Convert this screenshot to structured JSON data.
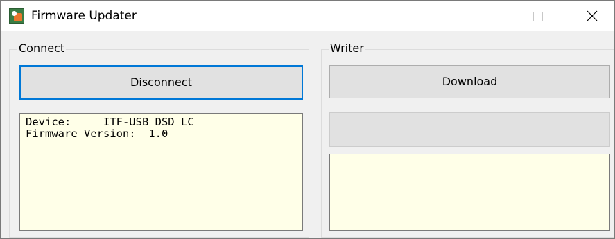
{
  "window": {
    "title": "Firmware Updater",
    "app_icon": "firmware-updater-app-icon",
    "controls": [
      "minimize",
      "maximize",
      "close"
    ]
  },
  "connect_group": {
    "legend": "Connect",
    "disconnect_label": "Disconnect",
    "device_info": {
      "line1": "Device:     ITF-USB DSD LC",
      "line2": "Firmware Version:  1.0"
    }
  },
  "writer_group": {
    "legend": "Writer",
    "download_label": "Download",
    "secondary_button_label": "",
    "log_text": ""
  },
  "colors": {
    "focus_border": "#0078d7",
    "textbox_background": "#ffffe8",
    "window_background": "#f0f0f0"
  }
}
